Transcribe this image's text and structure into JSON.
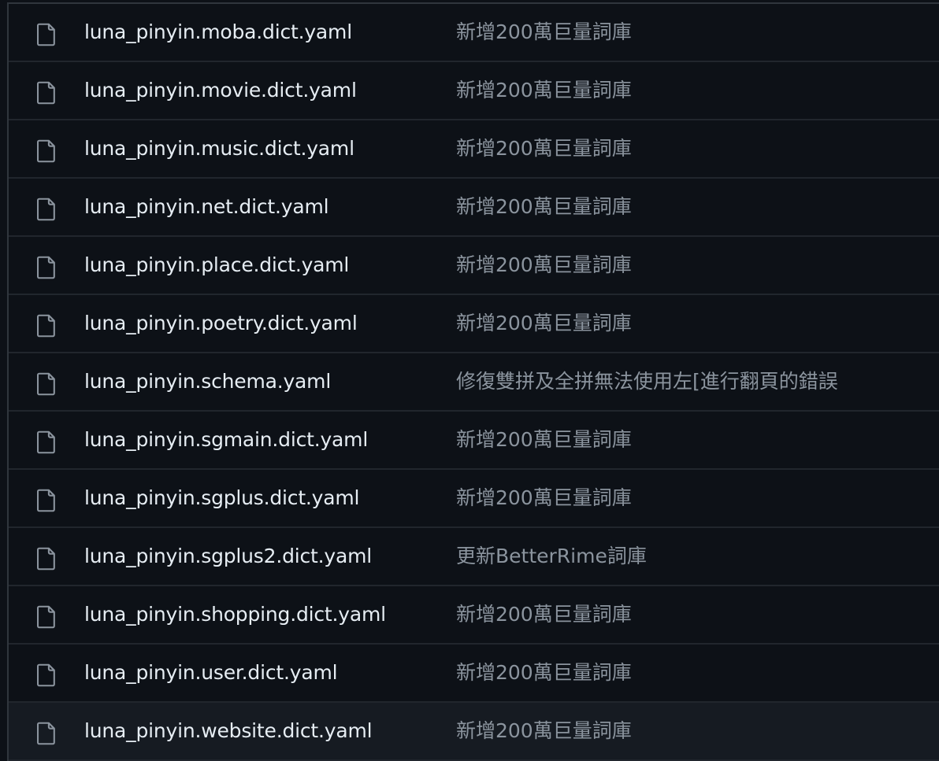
{
  "colors": {
    "background": "#0d1117",
    "row_hover": "#161b22",
    "border": "#21262d",
    "file_name": "#e6edf3",
    "commit_message": "#8b949e",
    "icon": "#8b949e"
  },
  "files": [
    {
      "icon": "file-icon",
      "name": "luna_pinyin.moba.dict.yaml",
      "commit": "新增200萬巨量詞庫"
    },
    {
      "icon": "file-icon",
      "name": "luna_pinyin.movie.dict.yaml",
      "commit": "新增200萬巨量詞庫"
    },
    {
      "icon": "file-icon",
      "name": "luna_pinyin.music.dict.yaml",
      "commit": "新增200萬巨量詞庫"
    },
    {
      "icon": "file-icon",
      "name": "luna_pinyin.net.dict.yaml",
      "commit": "新增200萬巨量詞庫"
    },
    {
      "icon": "file-icon",
      "name": "luna_pinyin.place.dict.yaml",
      "commit": "新增200萬巨量詞庫"
    },
    {
      "icon": "file-icon",
      "name": "luna_pinyin.poetry.dict.yaml",
      "commit": "新增200萬巨量詞庫"
    },
    {
      "icon": "file-icon",
      "name": "luna_pinyin.schema.yaml",
      "commit": "修復雙拼及全拼無法使用左[進行翻頁的錯誤"
    },
    {
      "icon": "file-icon",
      "name": "luna_pinyin.sgmain.dict.yaml",
      "commit": "新增200萬巨量詞庫"
    },
    {
      "icon": "file-icon",
      "name": "luna_pinyin.sgplus.dict.yaml",
      "commit": "新增200萬巨量詞庫"
    },
    {
      "icon": "file-icon",
      "name": "luna_pinyin.sgplus2.dict.yaml",
      "commit": "更新BetterRime詞庫"
    },
    {
      "icon": "file-icon",
      "name": "luna_pinyin.shopping.dict.yaml",
      "commit": "新增200萬巨量詞庫"
    },
    {
      "icon": "file-icon",
      "name": "luna_pinyin.user.dict.yaml",
      "commit": "新增200萬巨量詞庫"
    },
    {
      "icon": "file-icon",
      "name": "luna_pinyin.website.dict.yaml",
      "commit": "新增200萬巨量詞庫"
    }
  ]
}
